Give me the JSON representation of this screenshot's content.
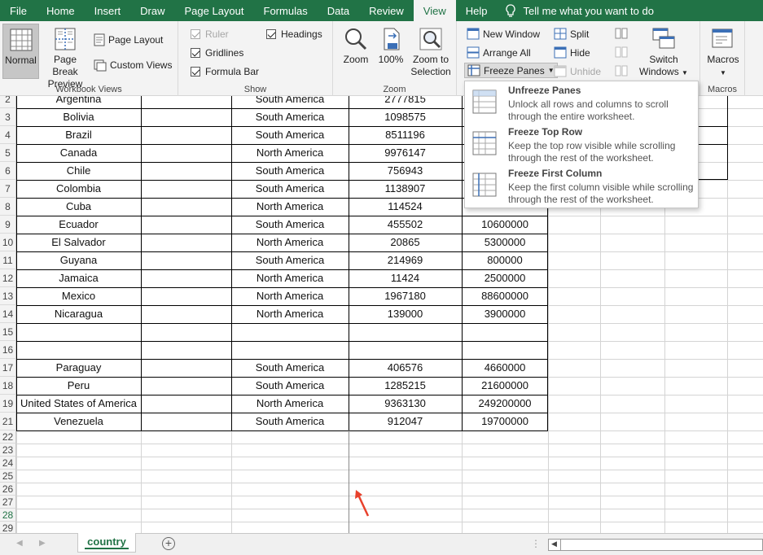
{
  "tabs": [
    "File",
    "Home",
    "Insert",
    "Draw",
    "Page Layout",
    "Formulas",
    "Data",
    "Review",
    "View",
    "Help"
  ],
  "active_tab": "View",
  "tell_me": "Tell me what you want to do",
  "ribbon": {
    "workbook_views": {
      "label": "Workbook Views",
      "normal": "Normal",
      "page_break_1": "Page Break",
      "page_break_2": "Preview",
      "page_layout": "Page Layout",
      "custom_views": "Custom Views"
    },
    "show": {
      "label": "Show",
      "ruler": "Ruler",
      "headings": "Headings",
      "gridlines": "Gridlines",
      "formula_bar": "Formula Bar"
    },
    "zoom": {
      "label": "Zoom",
      "zoom": "Zoom",
      "hundred": "100%",
      "zoom_sel_1": "Zoom to",
      "zoom_sel_2": "Selection"
    },
    "window": {
      "new_window": "New Window",
      "arrange_all": "Arrange All",
      "freeze_panes": "Freeze Panes",
      "split": "Split",
      "hide": "Hide",
      "unhide": "Unhide",
      "switch_1": "Switch",
      "switch_2": "Windows"
    },
    "macros": {
      "label": "Macros",
      "macros": "Macros"
    }
  },
  "dropdown": [
    {
      "title": "Unfreeze Panes",
      "desc": "Unlock all rows and columns to scroll through the entire worksheet."
    },
    {
      "title": "Freeze Top Row",
      "desc": "Keep the top row visible while scrolling through the rest of the worksheet."
    },
    {
      "title": "Freeze First Column",
      "desc": "Keep the first column visible while scrolling through the rest of the worksheet."
    }
  ],
  "rows": [
    {
      "n": "2",
      "country": "Argentina",
      "continent": "South America",
      "area": "2777815",
      "pop": ""
    },
    {
      "n": "3",
      "country": "Bolivia",
      "continent": "South America",
      "area": "1098575",
      "pop": ""
    },
    {
      "n": "4",
      "country": "Brazil",
      "continent": "South America",
      "area": "8511196",
      "pop": ""
    },
    {
      "n": "5",
      "country": "Canada",
      "continent": "North America",
      "area": "9976147",
      "pop": ""
    },
    {
      "n": "6",
      "country": "Chile",
      "continent": "South America",
      "area": "756943",
      "pop": ""
    },
    {
      "n": "7",
      "country": "Colombia",
      "continent": "South America",
      "area": "1138907",
      "pop": ""
    },
    {
      "n": "8",
      "country": "Cuba",
      "continent": "North America",
      "area": "114524",
      "pop": ""
    },
    {
      "n": "9",
      "country": "Ecuador",
      "continent": "South America",
      "area": "455502",
      "pop": "10600000"
    },
    {
      "n": "10",
      "country": "El Salvador",
      "continent": "North America",
      "area": "20865",
      "pop": "5300000"
    },
    {
      "n": "11",
      "country": "Guyana",
      "continent": "South America",
      "area": "214969",
      "pop": "800000"
    },
    {
      "n": "12",
      "country": "Jamaica",
      "continent": "North America",
      "area": "11424",
      "pop": "2500000"
    },
    {
      "n": "13",
      "country": "Mexico",
      "continent": "North America",
      "area": "1967180",
      "pop": "88600000"
    },
    {
      "n": "14",
      "country": "Nicaragua",
      "continent": "North America",
      "area": "139000",
      "pop": "3900000"
    },
    {
      "n": "15",
      "country": "",
      "continent": "",
      "area": "",
      "pop": ""
    },
    {
      "n": "16",
      "country": "",
      "continent": "",
      "area": "",
      "pop": ""
    },
    {
      "n": "17",
      "country": "Paraguay",
      "continent": "South America",
      "area": "406576",
      "pop": "4660000"
    },
    {
      "n": "18",
      "country": "Peru",
      "continent": "South America",
      "area": "1285215",
      "pop": "21600000"
    },
    {
      "n": "19",
      "country": "United States of America",
      "continent": "North America",
      "area": "9363130",
      "pop": "249200000"
    },
    {
      "n": "21",
      "country": "Venezuela",
      "continent": "South America",
      "area": "912047",
      "pop": "19700000"
    },
    {
      "n": "22",
      "country": "",
      "continent": "",
      "area": "",
      "pop": ""
    },
    {
      "n": "23",
      "country": "",
      "continent": "",
      "area": "",
      "pop": ""
    },
    {
      "n": "24",
      "country": "",
      "continent": "",
      "area": "",
      "pop": ""
    },
    {
      "n": "25",
      "country": "",
      "continent": "",
      "area": "",
      "pop": ""
    },
    {
      "n": "26",
      "country": "",
      "continent": "",
      "area": "",
      "pop": ""
    },
    {
      "n": "27",
      "country": "",
      "continent": "",
      "area": "",
      "pop": ""
    },
    {
      "n": "28",
      "country": "",
      "continent": "",
      "area": "",
      "pop": ""
    },
    {
      "n": "29",
      "country": "",
      "continent": "",
      "area": "",
      "pop": ""
    }
  ],
  "selected_row": "28",
  "sheet_tab": "country",
  "colors": {
    "excel_green": "#217346",
    "annotation_arrow": "#e8412c"
  }
}
